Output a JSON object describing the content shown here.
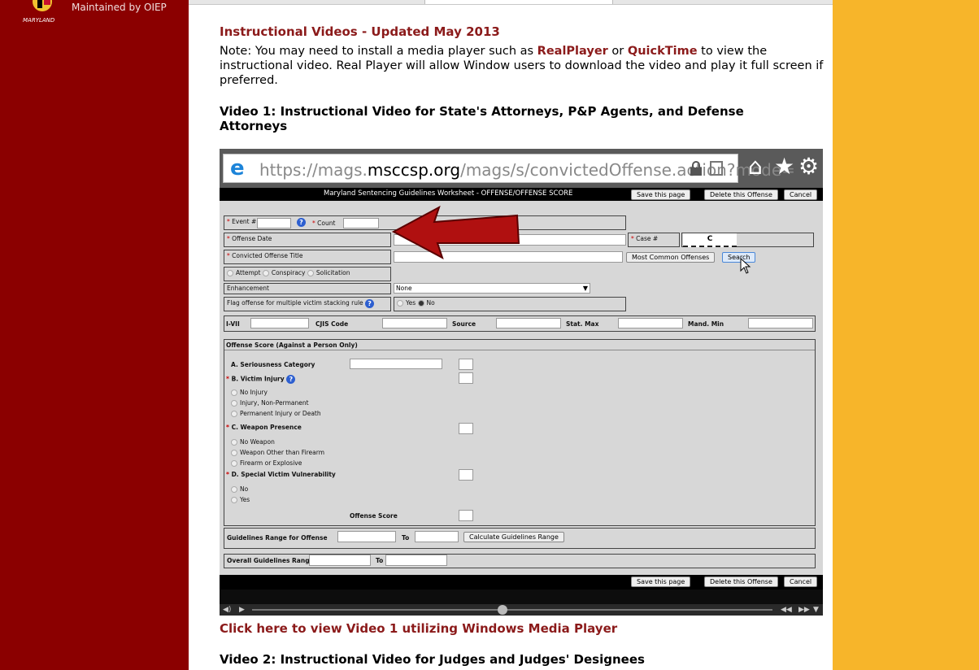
{
  "header": {
    "maintained_by": "Maintained by OIEP"
  },
  "content": {
    "heading": "Instructional Videos - Updated May 2013",
    "note_before": "Note:  You may need to install a media player such as ",
    "realplayer": "RealPlayer",
    "note_or": " or ",
    "quicktime": "QuickTime",
    "note_after": " to view the instructional video.  Real Player will allow Window users to download the video and play it full screen if preferred.",
    "video1_title": "Video 1:  Instructional Video for State's Attorneys, P&P Agents, and Defense Attorneys",
    "video1_link": "Click here to view Video 1 utilizing Windows Media Player",
    "video2_title": "Video 2:  Instructional Video for Judges and Judges' Designees"
  },
  "video": {
    "url_gray_1": "https://mags.",
    "url_domain": "msccsp.org",
    "url_gray_2": "/mags/s/convictedOffense.action?mode=",
    "form": {
      "title": "Maryland Sentencing Guidelines Worksheet - OFFENSE/OFFENSE SCORE",
      "save": "Save this page",
      "delete": "Delete this Offense",
      "cancel": "Cancel",
      "event": "Event #",
      "count": "Count",
      "offense_date": "Offense Date",
      "case": "Case #",
      "case_value": "C",
      "convicted_title": "Convicted Offense Title",
      "most_common": "Most Common Offenses",
      "search": "Search",
      "attempt": "Attempt",
      "conspiracy": "Conspiracy",
      "solicitation": "Solicitation",
      "enhancement": "Enhancement",
      "enhancement_value": "None",
      "flag": "Flag offense for multiple victim stacking rule",
      "yes": "Yes",
      "no": "No",
      "i_vii": "I-VII",
      "cjis": "CJIS Code",
      "source": "Source",
      "stat_max": "Stat. Max",
      "mand_min": "Mand. Min",
      "offense_score_header": "Offense Score (Against a Person Only)",
      "seriousness": "A. Seriousness Category",
      "victim_injury": "B. Victim Injury",
      "injury_options": [
        "No Injury",
        "Injury, Non-Permanent",
        "Permanent Injury or Death"
      ],
      "weapon": "C. Weapon Presence",
      "weapon_options": [
        "No Weapon",
        "Weapon Other than Firearm",
        "Firearm or Explosive"
      ],
      "vulnerability": "D. Special Victim Vulnerability",
      "vulnerability_options": [
        "No",
        "Yes"
      ],
      "offense_score": "Offense Score",
      "guidelines_range": "Guidelines Range for Offense",
      "to": "To",
      "calculate": "Calculate Guidelines Range",
      "overall_range": "Overall Guidelines Range"
    }
  },
  "colors": {
    "left_band": "#8b0000",
    "right_band": "#f7b52a",
    "link": "#8b1a1a",
    "arrow": "#b01010"
  }
}
